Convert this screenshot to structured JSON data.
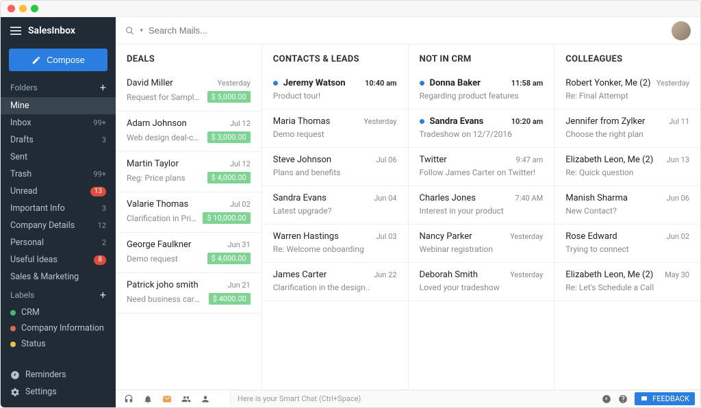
{
  "app": {
    "title": "SalesInbox"
  },
  "compose": {
    "label": "Compose"
  },
  "search": {
    "placeholder": "Search Mails..."
  },
  "sections": {
    "folders_label": "Folders",
    "labels_label": "Labels"
  },
  "folders": [
    {
      "name": "Mine",
      "count": "",
      "badge": "",
      "active": true
    },
    {
      "name": "Inbox",
      "count": "99+",
      "badge": ""
    },
    {
      "name": "Drafts",
      "count": "3",
      "badge": ""
    },
    {
      "name": "Sent",
      "count": "",
      "badge": ""
    },
    {
      "name": "Trash",
      "count": "99+",
      "badge": ""
    },
    {
      "name": "Unread",
      "count": "",
      "badge": "13"
    },
    {
      "name": "Important Info",
      "count": "3",
      "badge": ""
    },
    {
      "name": "Company Details",
      "count": "12",
      "badge": ""
    },
    {
      "name": "Personal",
      "count": "2",
      "badge": ""
    },
    {
      "name": "Useful Ideas",
      "count": "",
      "badge": "8"
    },
    {
      "name": "Sales & Marketing",
      "count": "",
      "badge": ""
    }
  ],
  "labels": [
    {
      "name": "CRM",
      "color": "#3bbf73"
    },
    {
      "name": "Company Information",
      "color": "#e06a4b"
    },
    {
      "name": "Status",
      "color": "#e8c24a"
    }
  ],
  "sidebar_bottom": {
    "reminders": "Reminders",
    "settings": "Settings"
  },
  "columns": [
    {
      "title": "DEALS",
      "items": [
        {
          "sender": "David Miller",
          "time": "Yesterday",
          "subject": "Request for Sample logo...",
          "amount": "$ 5,000.00",
          "unread": false
        },
        {
          "sender": "Adam Johnson",
          "time": "Jul 12",
          "subject": "Web design deal-confirma...",
          "amount": "$ 3,000.00",
          "unread": false
        },
        {
          "sender": "Martin Taylor",
          "time": "Jul 12",
          "subject": "Reg: Price plans",
          "amount": "$ 4,000.00",
          "unread": false
        },
        {
          "sender": "Valarie Thomas",
          "time": "Jul 02",
          "subject": "Clarification in Pricing",
          "amount": "$ 10,000.00",
          "unread": false
        },
        {
          "sender": "George Faulkner",
          "time": "Jun 31",
          "subject": "Demo request",
          "amount": "$ 4,000.00",
          "unread": false
        },
        {
          "sender": "Patrick joho smith",
          "time": "Jun 21",
          "subject": "Need business cards desi...",
          "amount": "$ 4000.00",
          "unread": false
        }
      ]
    },
    {
      "title": "CONTACTS & LEADS",
      "items": [
        {
          "sender": "Jeremy Watson",
          "time": "10:40 am",
          "subject": "Product tour!",
          "amount": "",
          "unread": true
        },
        {
          "sender": "Maria Thomas",
          "time": "Yesterday",
          "subject": "Demo request",
          "amount": "",
          "unread": false
        },
        {
          "sender": "Steve Johnson",
          "time": "Jul 06",
          "subject": "Plans and benefits",
          "amount": "",
          "unread": false
        },
        {
          "sender": "Sandra Evans",
          "time": "Jun 04",
          "subject": "Latest upgrade?",
          "amount": "",
          "unread": false
        },
        {
          "sender": "Warren Hastings",
          "time": "Jul 03",
          "subject": "Re: Welcome onboarding",
          "amount": "",
          "unread": false
        },
        {
          "sender": "James Carter",
          "time": "Jun 22",
          "subject": "Clarification in the design..",
          "amount": "",
          "unread": false
        }
      ]
    },
    {
      "title": "NOT IN CRM",
      "items": [
        {
          "sender": "Donna Baker",
          "time": "11:58 am",
          "subject": "Regarding product features",
          "amount": "",
          "unread": true
        },
        {
          "sender": "Sandra Evans",
          "time": "10:20 am",
          "subject": "Tradeshow on 12/7/2016",
          "amount": "",
          "unread": true
        },
        {
          "sender": "Twitter",
          "time": "9:47 am",
          "subject": "Follow James Carter on Twitter!",
          "amount": "",
          "unread": false
        },
        {
          "sender": "Charles Jones",
          "time": "7:40 AM",
          "subject": "Interest in your product",
          "amount": "",
          "unread": false
        },
        {
          "sender": "Nancy Parker",
          "time": "Yesterday",
          "subject": "Webinar registration",
          "amount": "",
          "unread": false
        },
        {
          "sender": "Deborah Smith",
          "time": "Yesterday",
          "subject": "Loved your tradeshow",
          "amount": "",
          "unread": false
        }
      ]
    },
    {
      "title": "COLLEAGUES",
      "items": [
        {
          "sender": "Robert Yonker, Me (2)",
          "time": "Yesterday",
          "subject": "Re: Final Attempt",
          "amount": "",
          "unread": false
        },
        {
          "sender": "Jennifer from Zylker",
          "time": "Jul 11",
          "subject": "Choose the right plan",
          "amount": "",
          "unread": false
        },
        {
          "sender": "Elizabeth Leon, Me (2)",
          "time": "Jun 13",
          "subject": "Re: Quick question",
          "amount": "",
          "unread": false
        },
        {
          "sender": "Manish Sharma",
          "time": "Jun 06",
          "subject": "New Contact?",
          "amount": "",
          "unread": false
        },
        {
          "sender": "Rose Edward",
          "time": "Jun 02",
          "subject": "Trying to connect",
          "amount": "",
          "unread": false
        },
        {
          "sender": "Elizabeth Leon, Me (2)",
          "time": "May 30",
          "subject": "Re: Let's Schedule a Call",
          "amount": "",
          "unread": false
        }
      ]
    }
  ],
  "bottombar": {
    "smartchat": "Here is your Smart Chat (Ctrl+Space)",
    "feedback": "FEEDBACK"
  }
}
